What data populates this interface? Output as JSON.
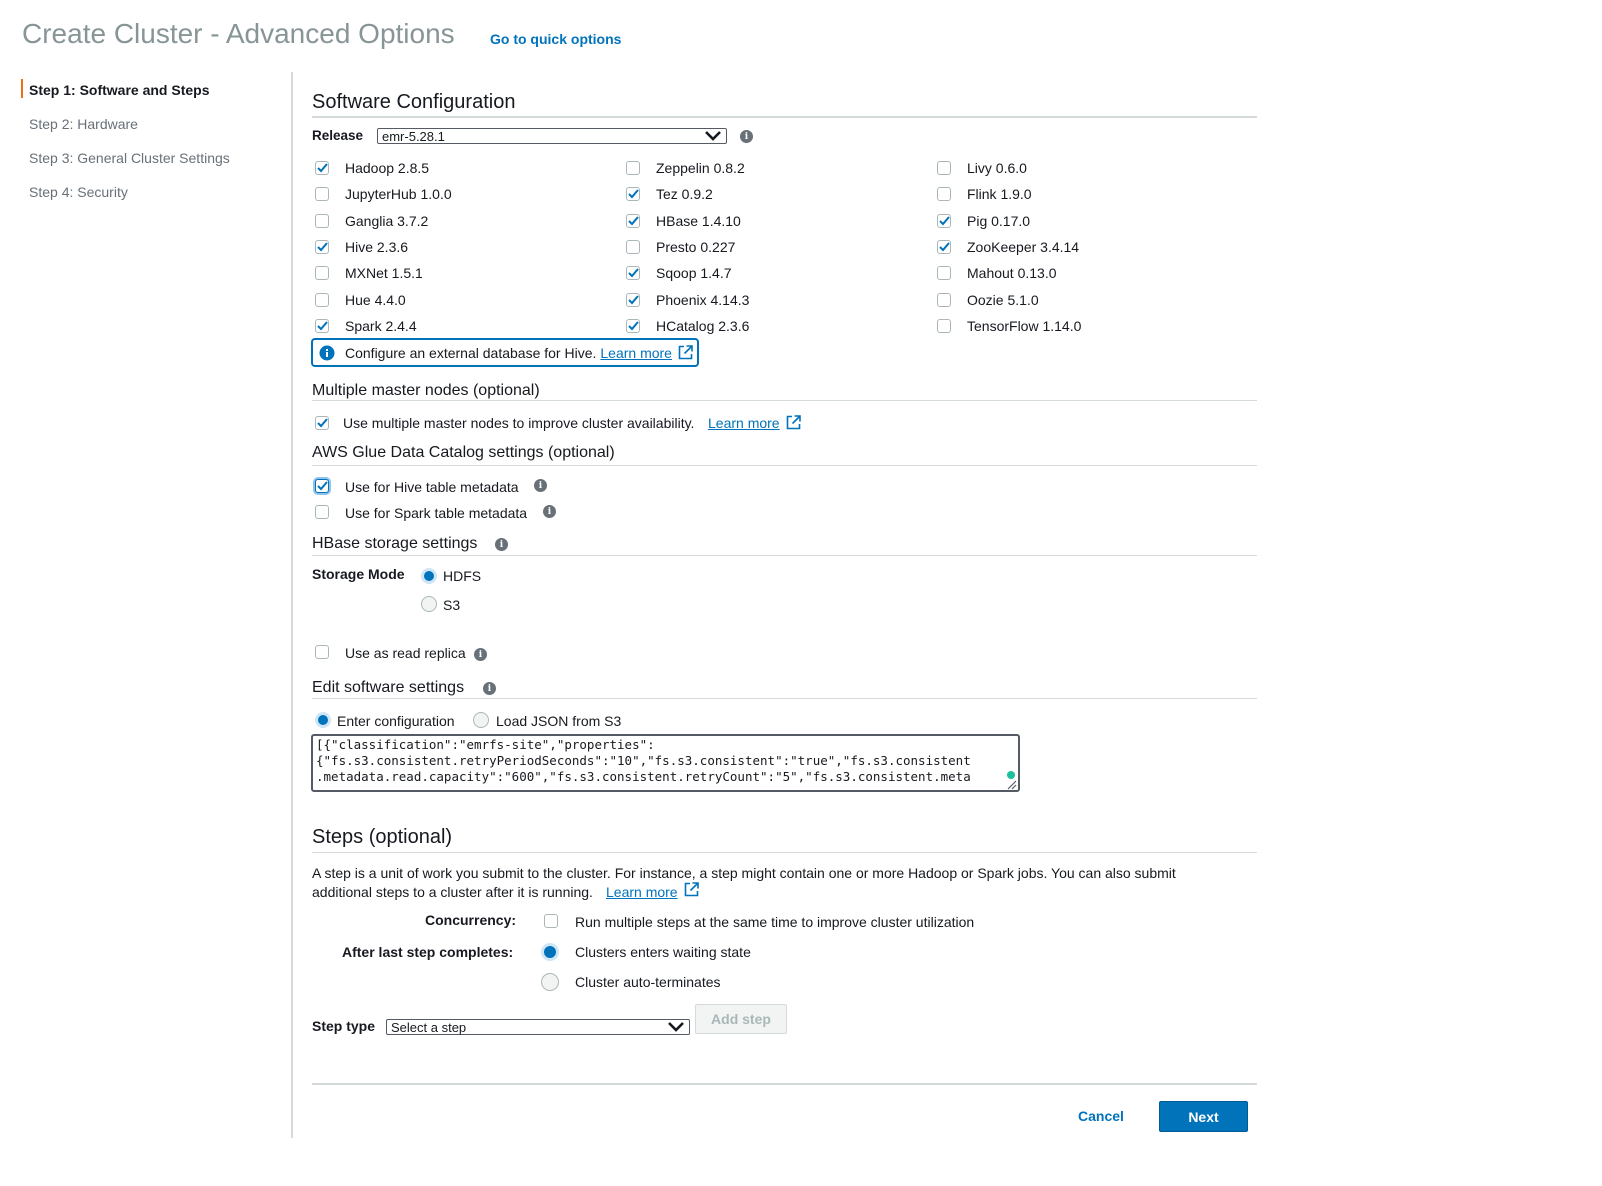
{
  "header": {
    "title": "Create Cluster - Advanced Options",
    "quick_link": "Go to quick options"
  },
  "sidebar": {
    "steps": [
      {
        "label": "Step 1: Software and Steps",
        "active": true
      },
      {
        "label": "Step 2: Hardware",
        "active": false
      },
      {
        "label": "Step 3: General Cluster Settings",
        "active": false
      },
      {
        "label": "Step 4: Security",
        "active": false
      }
    ]
  },
  "software": {
    "title": "Software Configuration",
    "release_label": "Release",
    "release_value": "emr-5.28.1",
    "apps": {
      "col1": [
        {
          "label": "Hadoop 2.8.5",
          "checked": true
        },
        {
          "label": "JupyterHub 1.0.0",
          "checked": false
        },
        {
          "label": "Ganglia 3.7.2",
          "checked": false
        },
        {
          "label": "Hive 2.3.6",
          "checked": true
        },
        {
          "label": "MXNet 1.5.1",
          "checked": false
        },
        {
          "label": "Hue 4.4.0",
          "checked": false
        },
        {
          "label": "Spark 2.4.4",
          "checked": true
        }
      ],
      "col2": [
        {
          "label": "Zeppelin 0.8.2",
          "checked": false
        },
        {
          "label": "Tez 0.9.2",
          "checked": true
        },
        {
          "label": "HBase 1.4.10",
          "checked": true
        },
        {
          "label": "Presto 0.227",
          "checked": false
        },
        {
          "label": "Sqoop 1.4.7",
          "checked": true
        },
        {
          "label": "Phoenix 4.14.3",
          "checked": true
        },
        {
          "label": "HCatalog 2.3.6",
          "checked": true
        }
      ],
      "col3": [
        {
          "label": "Livy 0.6.0",
          "checked": false
        },
        {
          "label": "Flink 1.9.0",
          "checked": false
        },
        {
          "label": "Pig 0.17.0",
          "checked": true
        },
        {
          "label": "ZooKeeper 3.4.14",
          "checked": true
        },
        {
          "label": "Mahout 0.13.0",
          "checked": false
        },
        {
          "label": "Oozie 5.1.0",
          "checked": false
        },
        {
          "label": "TensorFlow 1.14.0",
          "checked": false
        }
      ]
    },
    "info_text": "Configure an external database for Hive.",
    "learn_more": "Learn more"
  },
  "multi_master": {
    "title": "Multiple master nodes (optional)",
    "checkbox_label": "Use multiple master nodes to improve cluster availability.",
    "learn_more": "Learn more"
  },
  "glue": {
    "title": "AWS Glue Data Catalog settings (optional)",
    "hive_label": "Use for Hive table metadata",
    "spark_label": "Use for Spark table metadata"
  },
  "hbase": {
    "title": "HBase storage settings",
    "storage_mode_label": "Storage Mode",
    "option_hdfs": "HDFS",
    "option_s3": "S3",
    "read_replica_label": "Use as read replica"
  },
  "edit_settings": {
    "title": "Edit software settings",
    "option_enter": "Enter configuration",
    "option_load": "Load JSON from S3",
    "config_lines": [
      "[{\"classification\":\"emrfs-site\",\"properties\":",
      "{\"fs.s3.consistent.retryPeriodSeconds\":\"10\",\"fs.s3.consistent\":\"true\",\"fs.s3.consistent",
      ".metadata.read.capacity\":\"600\",\"fs.s3.consistent.retryCount\":\"5\",\"fs.s3.consistent.meta"
    ]
  },
  "steps": {
    "title": "Steps (optional)",
    "description_line1": "A step is a unit of work you submit to the cluster. For instance, a step might contain one or more Hadoop or Spark jobs. You can also submit",
    "description_line2": "additional steps to a cluster after it is running.",
    "learn_more": "Learn more",
    "concurrency_label": "Concurrency:",
    "concurrency_option": "Run multiple steps at the same time to improve cluster utilization",
    "after_label": "After last step completes:",
    "after_option_wait": "Clusters enters waiting state",
    "after_option_terminate": "Cluster auto-terminates",
    "step_type_label": "Step type",
    "step_type_value": "Select a step",
    "add_step": "Add step"
  },
  "footer": {
    "cancel": "Cancel",
    "next": "Next"
  },
  "colors": {
    "accent": "#0073bb",
    "active_step": "#ec7211",
    "divider": "#d5dbdb"
  }
}
